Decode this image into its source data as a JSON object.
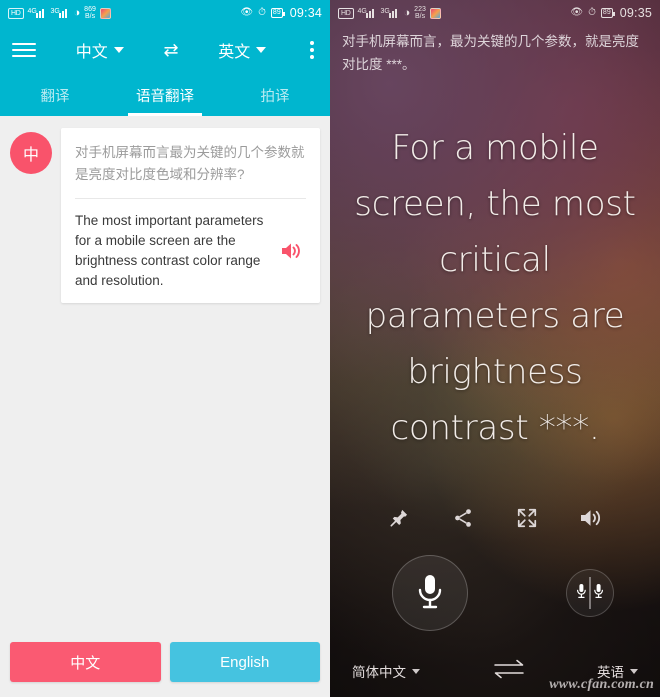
{
  "left": {
    "status_bar": {
      "hd_label": "HD",
      "sig1_gen": "4G",
      "sig2_gen": "3G",
      "net_speed_value": "869",
      "net_speed_unit": "B/s",
      "battery": "89",
      "clock": "09:34",
      "icons": [
        "hd-icon",
        "signal-icon",
        "signal-icon",
        "wifi-icon",
        "network-speed",
        "app-icon",
        "eye-icon",
        "alarm-icon",
        "battery-icon"
      ]
    },
    "toolbar": {
      "menu_icon": "hamburger-menu-icon",
      "source_lang": "中文",
      "swap_icon": "⇄",
      "target_lang": "英文",
      "overflow_icon": "overflow-menu-icon"
    },
    "tabs": [
      {
        "label": "翻译",
        "active": false
      },
      {
        "label": "语音翻译",
        "active": true
      },
      {
        "label": "拍译",
        "active": false
      }
    ],
    "message": {
      "avatar_label": "中",
      "source_text": "对手机屏幕而言最为关键的几个参数就是亮度对比度色域和分辨率?",
      "translated_text": "The most important parameters for a mobile screen are the brightness contrast color range and resolution.",
      "speaker_icon": "speaker-icon",
      "speaker_color": "#f9536b"
    },
    "bottom_buttons": [
      {
        "label": "中文",
        "color": "#fa5a72"
      },
      {
        "label": "English",
        "color": "#45c3e0"
      }
    ],
    "accent_color": "#00b6cf"
  },
  "right": {
    "status_bar": {
      "hd_label": "HD",
      "sig1_gen": "4G",
      "sig2_gen": "3G",
      "net_speed_value": "223",
      "net_speed_unit": "B/s",
      "battery": "89",
      "clock": "09:35"
    },
    "source_text": "对手机屏幕而言，最为关键的几个参数，就是亮度对比度 ***。",
    "translated_text": "For a mobile screen, the most critical parameters are brightness contrast ***.",
    "actions": [
      {
        "name": "pin-icon"
      },
      {
        "name": "share-icon"
      },
      {
        "name": "fullscreen-icon"
      },
      {
        "name": "volume-icon"
      }
    ],
    "mic_button": "microphone-icon",
    "dual_mic_button": "dual-microphone-icon",
    "bottom_bar": {
      "source_lang": "简体中文",
      "swap_icon": "swap-arrows-icon",
      "target_lang": "英语"
    },
    "watermark": "www.cfan.com.cn"
  }
}
